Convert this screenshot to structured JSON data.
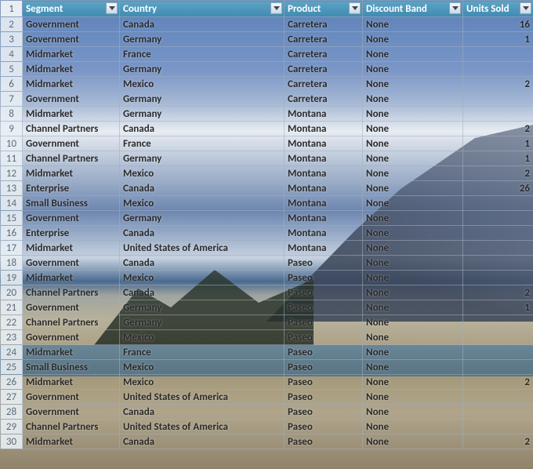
{
  "headers": {
    "segment": "Segment",
    "country": "Country",
    "product": "Product",
    "discount": "Discount Band",
    "units": "Units Sold"
  },
  "header_row_number": "1",
  "rows": [
    {
      "n": "2",
      "segment": "Government",
      "country": "Canada",
      "product": "Carretera",
      "discount": "None",
      "units": "16"
    },
    {
      "n": "3",
      "segment": "Government",
      "country": "Germany",
      "product": "Carretera",
      "discount": "None",
      "units": "1"
    },
    {
      "n": "4",
      "segment": "Midmarket",
      "country": "France",
      "product": "Carretera",
      "discount": "None",
      "units": ""
    },
    {
      "n": "5",
      "segment": "Midmarket",
      "country": "Germany",
      "product": "Carretera",
      "discount": "None",
      "units": ""
    },
    {
      "n": "6",
      "segment": "Midmarket",
      "country": "Mexico",
      "product": "Carretera",
      "discount": "None",
      "units": "2"
    },
    {
      "n": "7",
      "segment": "Government",
      "country": "Germany",
      "product": "Carretera",
      "discount": "None",
      "units": ""
    },
    {
      "n": "8",
      "segment": "Midmarket",
      "country": "Germany",
      "product": "Montana",
      "discount": "None",
      "units": ""
    },
    {
      "n": "9",
      "segment": "Channel Partners",
      "country": "Canada",
      "product": "Montana",
      "discount": "None",
      "units": "2"
    },
    {
      "n": "10",
      "segment": "Government",
      "country": "France",
      "product": "Montana",
      "discount": "None",
      "units": "1"
    },
    {
      "n": "11",
      "segment": "Channel Partners",
      "country": "Germany",
      "product": "Montana",
      "discount": "None",
      "units": "1"
    },
    {
      "n": "12",
      "segment": "Midmarket",
      "country": "Mexico",
      "product": "Montana",
      "discount": "None",
      "units": "2"
    },
    {
      "n": "13",
      "segment": "Enterprise",
      "country": "Canada",
      "product": "Montana",
      "discount": "None",
      "units": "26"
    },
    {
      "n": "14",
      "segment": "Small Business",
      "country": "Mexico",
      "product": "Montana",
      "discount": "None",
      "units": ""
    },
    {
      "n": "15",
      "segment": "Government",
      "country": "Germany",
      "product": "Montana",
      "discount": "None",
      "units": ""
    },
    {
      "n": "16",
      "segment": "Enterprise",
      "country": "Canada",
      "product": "Montana",
      "discount": "None",
      "units": ""
    },
    {
      "n": "17",
      "segment": "Midmarket",
      "country": "United States of America",
      "product": "Montana",
      "discount": "None",
      "units": ""
    },
    {
      "n": "18",
      "segment": "Government",
      "country": "Canada",
      "product": "Paseo",
      "discount": "None",
      "units": ""
    },
    {
      "n": "19",
      "segment": "Midmarket",
      "country": "Mexico",
      "product": "Paseo",
      "discount": "None",
      "units": ""
    },
    {
      "n": "20",
      "segment": "Channel Partners",
      "country": "Canada",
      "product": "Paseo",
      "discount": "None",
      "units": "2"
    },
    {
      "n": "21",
      "segment": "Government",
      "country": "Germany",
      "product": "Paseo",
      "discount": "None",
      "units": "1"
    },
    {
      "n": "22",
      "segment": "Channel Partners",
      "country": "Germany",
      "product": "Paseo",
      "discount": "None",
      "units": ""
    },
    {
      "n": "23",
      "segment": "Government",
      "country": "Mexico",
      "product": "Paseo",
      "discount": "None",
      "units": ""
    },
    {
      "n": "24",
      "segment": "Midmarket",
      "country": "France",
      "product": "Paseo",
      "discount": "None",
      "units": ""
    },
    {
      "n": "25",
      "segment": "Small Business",
      "country": "Mexico",
      "product": "Paseo",
      "discount": "None",
      "units": ""
    },
    {
      "n": "26",
      "segment": "Midmarket",
      "country": "Mexico",
      "product": "Paseo",
      "discount": "None",
      "units": "2"
    },
    {
      "n": "27",
      "segment": "Government",
      "country": "United States of America",
      "product": "Paseo",
      "discount": "None",
      "units": ""
    },
    {
      "n": "28",
      "segment": "Government",
      "country": "Canada",
      "product": "Paseo",
      "discount": "None",
      "units": ""
    },
    {
      "n": "29",
      "segment": "Channel Partners",
      "country": "United States of America",
      "product": "Paseo",
      "discount": "None",
      "units": ""
    },
    {
      "n": "30",
      "segment": "Midmarket",
      "country": "Canada",
      "product": "Paseo",
      "discount": "None",
      "units": "2"
    }
  ]
}
